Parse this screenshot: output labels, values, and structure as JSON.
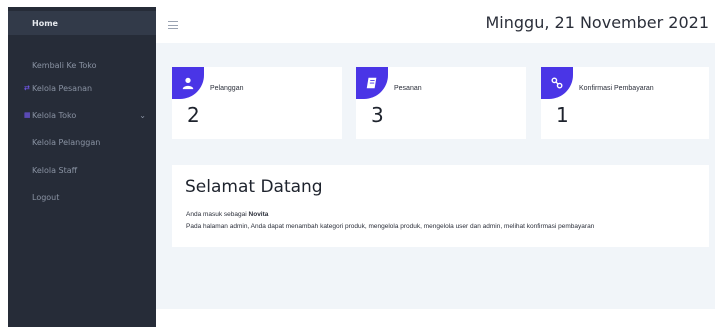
{
  "sidebar": {
    "items": [
      {
        "label": "Home",
        "active": true
      },
      {
        "label": "Kembali Ke Toko"
      },
      {
        "label": "Kelola Pesanan",
        "icon": "arrows-icon"
      },
      {
        "label": "Kelola Toko",
        "icon": "grid-icon",
        "chevron": "chevron-down-icon"
      },
      {
        "label": "Kelola Pelanggan"
      },
      {
        "label": "Kelola Staff"
      },
      {
        "label": "Logout"
      }
    ]
  },
  "header": {
    "date": "Minggu, 21 November 2021"
  },
  "cards": [
    {
      "label": "Pelanggan",
      "count": "2",
      "icon": "user-icon"
    },
    {
      "label": "Pesanan",
      "count": "3",
      "icon": "book-icon"
    },
    {
      "label": "Konfirmasi Pembayaran",
      "count": "1",
      "icon": "link-icon"
    }
  ],
  "welcome": {
    "title": "Selamat Datang",
    "prefix": "Anda masuk sebagai",
    "user": "Novita",
    "description": "Pada halaman admin, Anda dapat menambah kategori produk, mengelola produk, mengelola user dan admin, melihat konfirmasi pembayaran"
  },
  "colors": {
    "sidebar_bg": "#262c38",
    "accent": "#4a35e6",
    "page_bg": "#f1f5f9"
  }
}
